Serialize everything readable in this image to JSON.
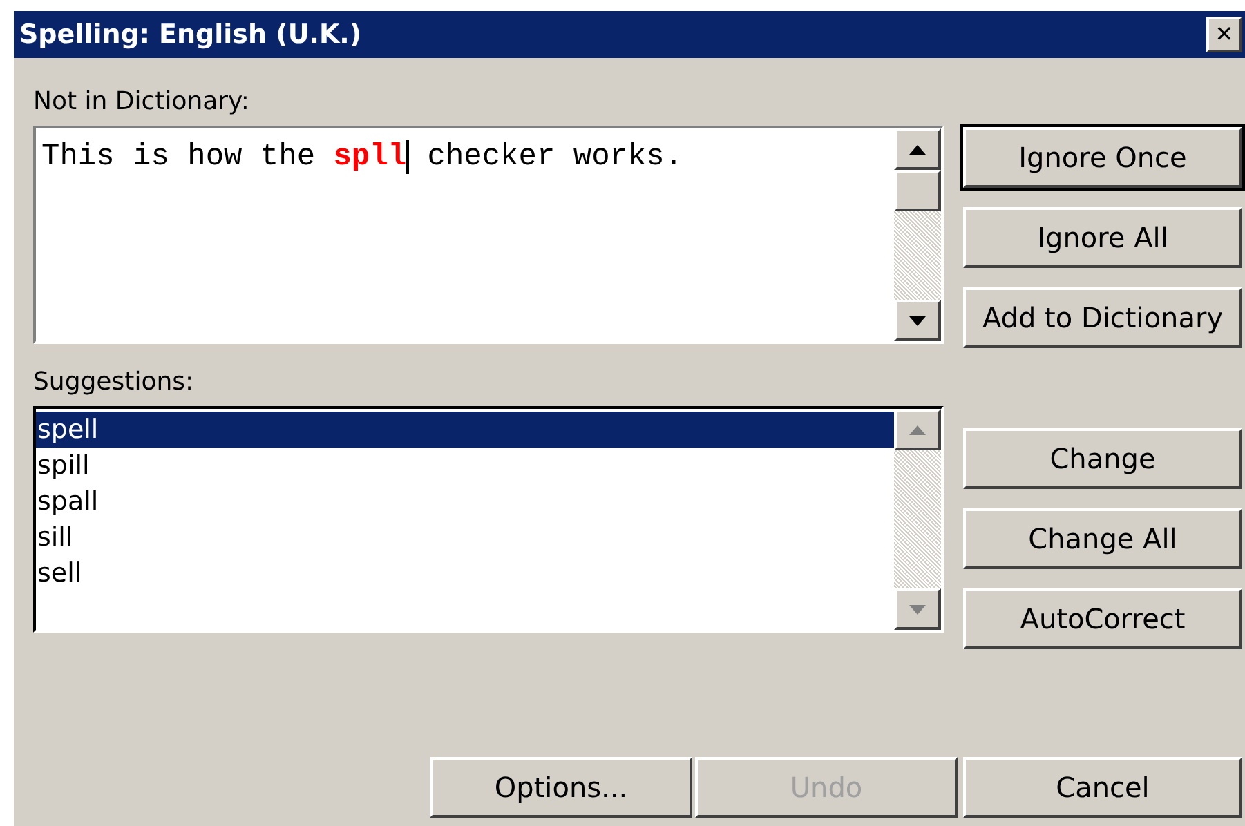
{
  "window": {
    "title": "Spelling: English (U.K.)",
    "close": "✕"
  },
  "not_in_dictionary": {
    "label": "Not in Dictionary:",
    "segments": [
      {
        "kind": "normal",
        "text": "This is how the "
      },
      {
        "kind": "error",
        "text": "spll"
      },
      {
        "kind": "normal",
        "text": " checker works."
      }
    ]
  },
  "side_buttons_top": [
    {
      "label": "Ignore Once",
      "default": true
    },
    {
      "label": "Ignore All",
      "default": false
    },
    {
      "label": "Add to Dictionary",
      "default": false
    }
  ],
  "suggestions": {
    "label": "Suggestions:",
    "items": [
      {
        "text": "spell",
        "selected": true
      },
      {
        "text": "spill",
        "selected": false
      },
      {
        "text": "spall",
        "selected": false
      },
      {
        "text": "sill",
        "selected": false
      },
      {
        "text": "sell",
        "selected": false
      }
    ]
  },
  "side_buttons_bottom": [
    {
      "label": "Change",
      "default": false
    },
    {
      "label": "Change All",
      "default": false
    },
    {
      "label": "AutoCorrect",
      "default": false
    }
  ],
  "footer_buttons": [
    {
      "label": "Options...",
      "disabled": false
    },
    {
      "label": "Undo",
      "disabled": true
    },
    {
      "label": "Cancel",
      "disabled": false
    }
  ]
}
